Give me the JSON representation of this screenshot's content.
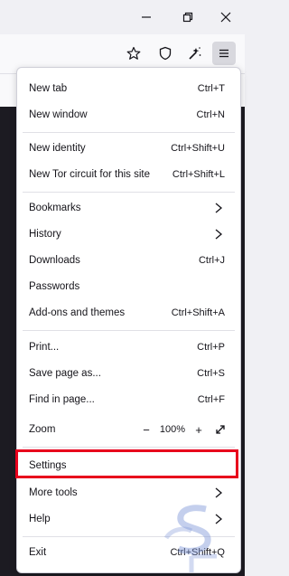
{
  "menu": {
    "items": [
      {
        "label": "New tab",
        "shortcut": "Ctrl+T"
      },
      {
        "label": "New window",
        "shortcut": "Ctrl+N"
      },
      {
        "label": "New identity",
        "shortcut": "Ctrl+Shift+U"
      },
      {
        "label": "New Tor circuit for this site",
        "shortcut": "Ctrl+Shift+L"
      },
      {
        "label": "Bookmarks",
        "shortcut": ""
      },
      {
        "label": "History",
        "shortcut": ""
      },
      {
        "label": "Downloads",
        "shortcut": "Ctrl+J"
      },
      {
        "label": "Passwords",
        "shortcut": ""
      },
      {
        "label": "Add-ons and themes",
        "shortcut": "Ctrl+Shift+A"
      },
      {
        "label": "Print...",
        "shortcut": "Ctrl+P"
      },
      {
        "label": "Save page as...",
        "shortcut": "Ctrl+S"
      },
      {
        "label": "Find in page...",
        "shortcut": "Ctrl+F"
      },
      {
        "label": "Zoom",
        "shortcut": ""
      },
      {
        "label": "Settings",
        "shortcut": ""
      },
      {
        "label": "More tools",
        "shortcut": ""
      },
      {
        "label": "Help",
        "shortcut": ""
      },
      {
        "label": "Exit",
        "shortcut": "Ctrl+Shift+Q"
      }
    ],
    "zoom": {
      "minus": "−",
      "value": "100%",
      "plus": "+"
    }
  },
  "icons": {
    "minimize": "minimize-icon",
    "restore": "restore-icon",
    "close": "close-icon",
    "bookmark_star": "star-icon",
    "shield": "shield-icon",
    "magic_wand": "magic-wand-icon",
    "menu": "hamburger-menu-icon",
    "chevron": "chevron-right-icon",
    "fullscreen": "fullscreen-icon"
  },
  "colors": {
    "highlight": "#e8001c",
    "background": "#f0f0f4",
    "content_dark": "#1c1b22"
  }
}
